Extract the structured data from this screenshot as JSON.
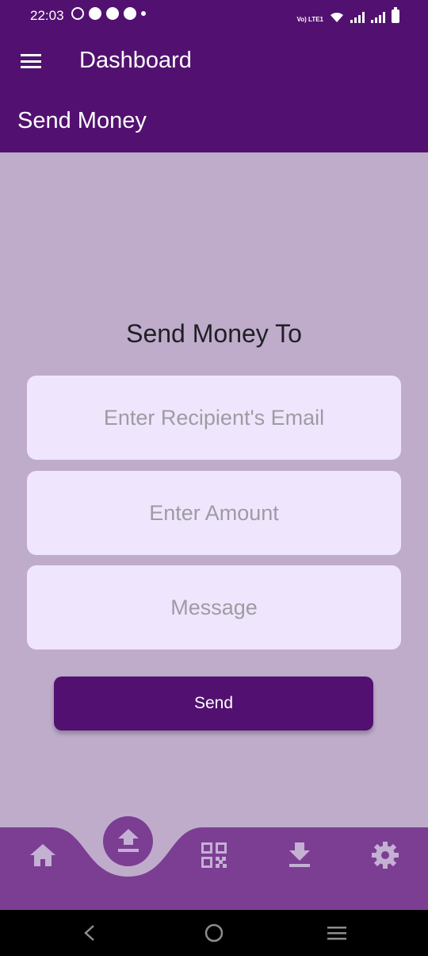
{
  "status_bar": {
    "time": "22:03",
    "notification_icons": [
      "whatsapp-icon",
      "messenger-icon",
      "compass-icon",
      "compass-icon",
      "dot-icon"
    ],
    "network_label": "Vo) LTE1"
  },
  "app_bar": {
    "menu_icon": "hamburger-menu-icon",
    "title": "Dashboard"
  },
  "page": {
    "title": "Send Money",
    "heading": "Send Money To"
  },
  "form": {
    "recipient_email": {
      "value": "",
      "placeholder": "Enter Recipient's Email"
    },
    "amount": {
      "value": "",
      "placeholder": "Enter Amount"
    },
    "message": {
      "value": "",
      "placeholder": "Message"
    },
    "send_label": "Send"
  },
  "bottom_nav": {
    "items": [
      {
        "name": "home",
        "icon": "home-icon"
      },
      {
        "name": "send",
        "icon": "upload-icon",
        "active": true
      },
      {
        "name": "qr",
        "icon": "qr-code-icon"
      },
      {
        "name": "receive",
        "icon": "download-icon"
      },
      {
        "name": "settings",
        "icon": "gear-icon"
      }
    ]
  },
  "system_nav": [
    "back-icon",
    "home-circle-icon",
    "recents-icon"
  ],
  "colors": {
    "primary": "#521170",
    "background": "#bfaccb",
    "field": "#efe6fd",
    "nav_bar": "#7b3e93",
    "nav_icon": "#c4b0d3"
  }
}
